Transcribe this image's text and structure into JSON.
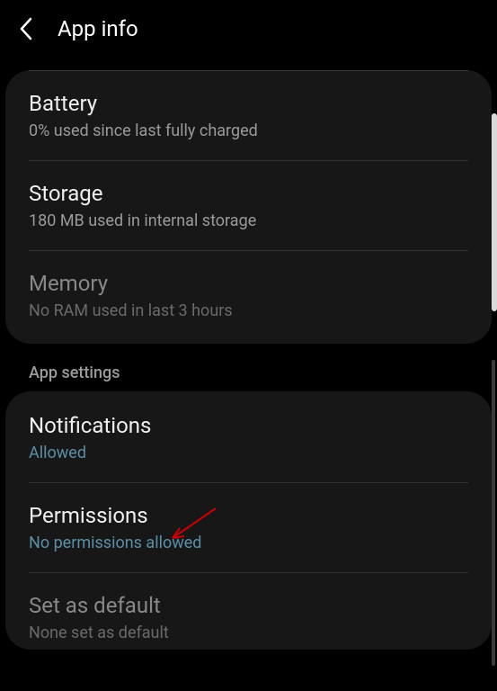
{
  "header": {
    "title": "App info"
  },
  "sections": {
    "usage": {
      "battery": {
        "title": "Battery",
        "subtitle": "0% used since last fully charged"
      },
      "storage": {
        "title": "Storage",
        "subtitle": "180 MB used in internal storage"
      },
      "memory": {
        "title": "Memory",
        "subtitle": "No RAM used in last 3 hours"
      }
    },
    "appSettings": {
      "label": "App settings",
      "notifications": {
        "title": "Notifications",
        "subtitle": "Allowed"
      },
      "permissions": {
        "title": "Permissions",
        "subtitle": "No permissions allowed"
      },
      "setDefault": {
        "title": "Set as default",
        "subtitle": "None set as default"
      }
    }
  }
}
